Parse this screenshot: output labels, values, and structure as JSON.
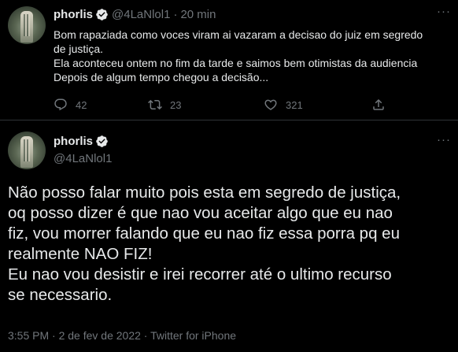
{
  "reply_tweet": {
    "display_name": "phorlis",
    "handle": "@4LaNlol1",
    "separator": "·",
    "time": "20 min",
    "text_lines": [
      "Bom rapaziada como voces viram ai vazaram a decisao do juiz em segredo",
      "de justiça.",
      "Ela aconteceu ontem no fim da tarde e saimos bem otimistas da audiencia",
      "Depois de algum tempo chegou a decisão..."
    ],
    "actions": {
      "reply_count": "42",
      "retweet_count": "23",
      "like_count": "321"
    }
  },
  "main_tweet": {
    "display_name": "phorlis",
    "handle": "@4LaNlol1",
    "text_lines": [
      "Não posso falar muito pois esta em segredo de justiça,",
      "oq posso dizer é que nao vou aceitar algo que eu nao",
      "fiz, vou morrer falando que eu nao fiz essa porra pq eu",
      "realmente NAO FIZ!",
      "Eu nao vou desistir e irei recorrer até o ultimo recurso",
      "se necessario."
    ],
    "meta": "3:55 PM · 2 de fev de 2022 · Twitter for iPhone"
  },
  "colors": {
    "background": "#000000",
    "text": "#e7e9ea",
    "muted": "#71767b",
    "divider": "#2f3336",
    "verified": "#e7e9ea"
  },
  "icons": [
    "verified-icon",
    "more-icon",
    "reply-icon",
    "retweet-icon",
    "like-icon",
    "share-icon"
  ]
}
